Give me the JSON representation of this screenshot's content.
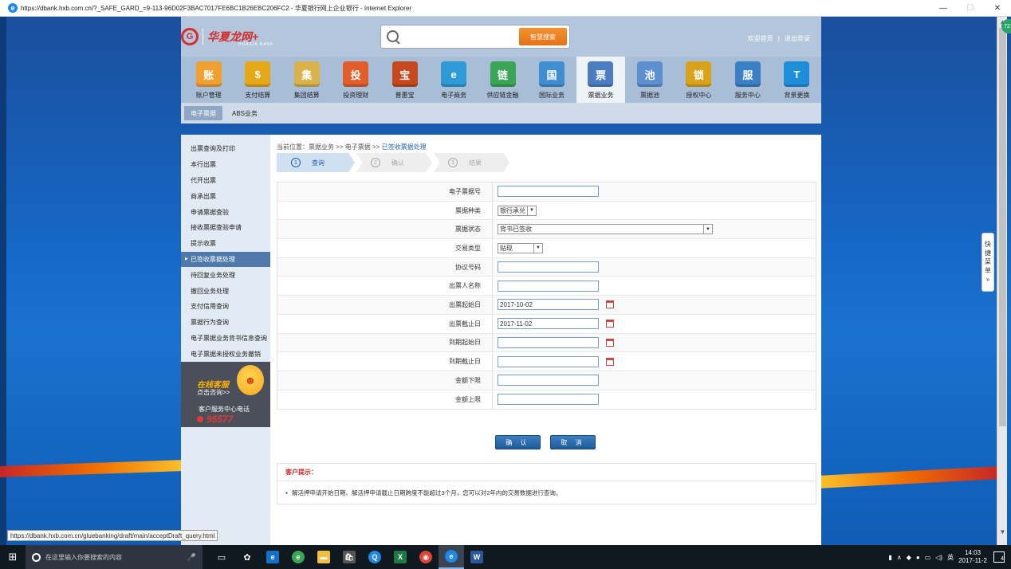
{
  "window": {
    "title": "https://dbank.hxb.com.cn/?_SAFE_GARD_=9-113-96D02F3BAC7017FE6BC1B26EBC206FC2 - 华夏银行网上企业银行 - Internet Explorer",
    "minimize": "—",
    "maximize": "☐",
    "close": "✕"
  },
  "header": {
    "logo_mark": "G",
    "logo_text": "华夏龙网+",
    "logo_sub": "HUAXIA BANK",
    "search_placeholder": "",
    "search_button": "智慧搜索",
    "welcome_link": "欢迎首页",
    "separator": "|",
    "logout_link": "退出登录"
  },
  "nav": {
    "items": [
      {
        "label": "账户管理",
        "icon": "account-icon",
        "color": "#f0a030",
        "glyph": "账"
      },
      {
        "label": "支付结算",
        "icon": "coins-icon",
        "color": "#e6a817",
        "glyph": "$"
      },
      {
        "label": "集团结算",
        "icon": "group-icon",
        "color": "#d9b24a",
        "glyph": "集"
      },
      {
        "label": "投资理财",
        "icon": "invest-icon",
        "color": "#e35d2b",
        "glyph": "投"
      },
      {
        "label": "普惠宝",
        "icon": "treasure-icon",
        "color": "#c8481e",
        "glyph": "宝"
      },
      {
        "label": "电子商务",
        "icon": "ecommerce-icon",
        "color": "#2e9bd6",
        "glyph": "e"
      },
      {
        "label": "供应链金融",
        "icon": "supply-chain-icon",
        "color": "#3aa655",
        "glyph": "链"
      },
      {
        "label": "国际业务",
        "icon": "globe-icon",
        "color": "#3f8fd0",
        "glyph": "国"
      },
      {
        "label": "票据业务",
        "icon": "bill-icon",
        "color": "#4a7dbf",
        "glyph": "票"
      },
      {
        "label": "票据池",
        "icon": "bill-pool-icon",
        "color": "#5b8fd0",
        "glyph": "池"
      },
      {
        "label": "授权中心",
        "icon": "lock-icon",
        "color": "#d9a21b",
        "glyph": "锁"
      },
      {
        "label": "服务中心",
        "icon": "service-icon",
        "color": "#3b7fc4",
        "glyph": "服"
      },
      {
        "label": "背景更换",
        "icon": "shirt-icon",
        "color": "#1f8ed8",
        "glyph": "T"
      }
    ],
    "active_index": 8
  },
  "subnav": {
    "items": [
      "电子票据",
      "ABS业务"
    ]
  },
  "sidebar": {
    "items": [
      "出票查询及打印",
      "本行出票",
      "代开出票",
      "商承出票",
      "申请票据查验",
      "接收票据查验申请",
      "提示收票",
      "已签收票据处理",
      "待回复业务处理",
      "撤回业务处理",
      "支付信用查询",
      "票据行为查询",
      "电子票据业务背书信息查询",
      "电子票据未授权业务撤销"
    ],
    "active_index": 7,
    "service": {
      "title": "在线客服",
      "subtitle": "点击咨询>>",
      "phone_label": "客户服务中心电话",
      "phone": "95577"
    }
  },
  "breadcrumb": {
    "prefix": "当前位置：票据业务 >> 电子票据 >> ",
    "current": "已签收票据处理"
  },
  "steps": [
    {
      "num": "1",
      "label": "查询"
    },
    {
      "num": "2",
      "label": "确认"
    },
    {
      "num": "3",
      "label": "结果"
    }
  ],
  "form": {
    "bill_no": {
      "label": "电子票据号",
      "value": ""
    },
    "bill_type": {
      "label": "票据种类",
      "value": "银行承兑"
    },
    "bill_status": {
      "label": "票据状态",
      "value": "背书已签收"
    },
    "trade_type": {
      "label": "交易类型",
      "value": "贴现"
    },
    "agreement_no": {
      "label": "协议号码",
      "value": ""
    },
    "drawer_name": {
      "label": "出票人名称",
      "value": ""
    },
    "issue_start": {
      "label": "出票起始日",
      "value": "2017-10-02"
    },
    "issue_end": {
      "label": "出票截止日",
      "value": "2017-11-02"
    },
    "due_start": {
      "label": "到期起始日",
      "value": ""
    },
    "due_end": {
      "label": "到期截止日",
      "value": ""
    },
    "amount_min": {
      "label": "金额下限",
      "value": ""
    },
    "amount_max": {
      "label": "金额上限",
      "value": ""
    }
  },
  "buttons": {
    "confirm": "确 认",
    "cancel": "取 消"
  },
  "tips": {
    "title": "客户提示：",
    "text": "解活押申请开始日期、解活押申请截止日期跨度不能超过3个月，您可以对2年内的交易数据进行查询。"
  },
  "right_panel": {
    "badge": "72",
    "quick_menu": [
      "快",
      "捷",
      "菜",
      "单",
      "»"
    ]
  },
  "status_bar": {
    "url": "https://dbank.hxb.com.cn/gluebanking/draft/main/acceptDraft_query.html"
  },
  "taskbar": {
    "search_placeholder": "在这里输入你要搜索的内容",
    "time": "14:03",
    "date": "2017-11-2",
    "ime": "英",
    "notifications": "4"
  }
}
